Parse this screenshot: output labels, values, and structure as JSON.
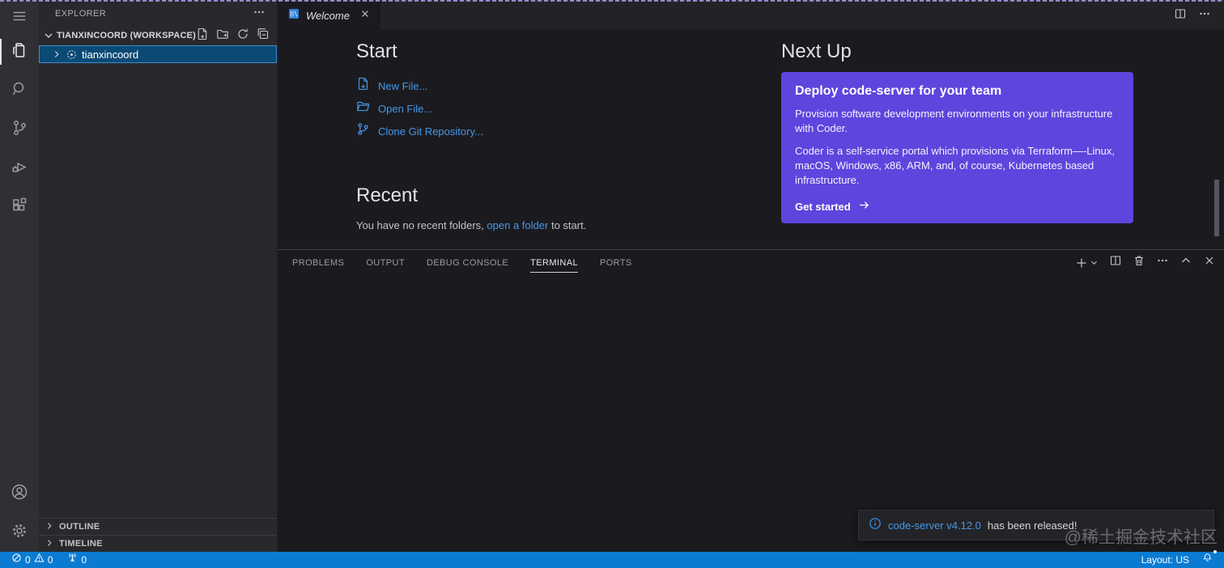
{
  "sidebar": {
    "title": "EXPLORER",
    "workspace_label": "TIANXINCOORD (WORKSPACE)",
    "tree_item": "tianxincoord",
    "outline_label": "OUTLINE",
    "timeline_label": "TIMELINE"
  },
  "tabs": {
    "welcome_label": "Welcome"
  },
  "welcome": {
    "start_heading": "Start",
    "links": {
      "new_file": "New File...",
      "open_file": "Open File...",
      "clone_repo": "Clone Git Repository..."
    },
    "recent_heading": "Recent",
    "recent_prefix": "You have no recent folders,",
    "recent_link": "open a folder",
    "recent_suffix": "to start.",
    "nextup_heading": "Next Up",
    "card": {
      "title": "Deploy code-server for your team",
      "body1": "Provision software development environments on your infrastructure with Coder.",
      "body2": "Coder is a self-service portal which provisions via Terraform—-Linux, macOS, Windows, x86, ARM, and, of course, Kubernetes based infrastructure.",
      "cta": "Get started"
    }
  },
  "panel": {
    "tabs": [
      "PROBLEMS",
      "OUTPUT",
      "DEBUG CONSOLE",
      "TERMINAL",
      "PORTS"
    ],
    "active": "TERMINAL"
  },
  "notification": {
    "link_text": "code-server v4.12.0",
    "message": "has been released!"
  },
  "status_bar": {
    "errors": "0",
    "warnings": "0",
    "ports": "0",
    "layout": "Layout: US"
  },
  "watermark": "@稀土掘金技术社区",
  "colors": {
    "accent_blue": "#4897e8",
    "card_purple": "#5e45dd",
    "statusbar_blue": "#0b7bd2",
    "selection_blue": "#0a4a75",
    "toast_bg": "#242428"
  }
}
